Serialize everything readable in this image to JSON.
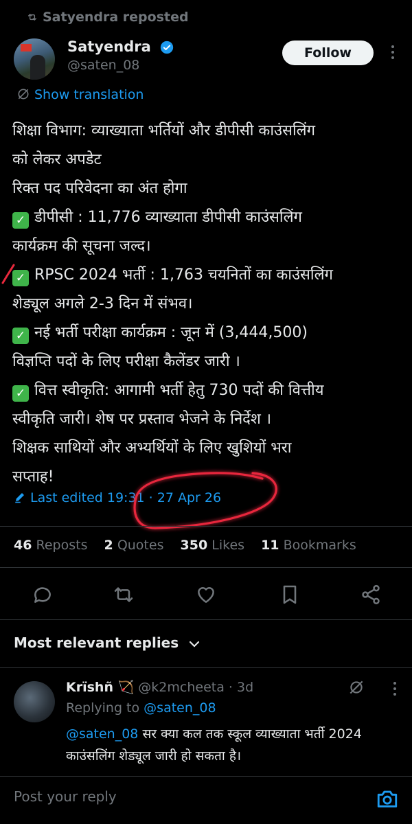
{
  "repost_bar": {
    "text": "Satyendra reposted"
  },
  "author": {
    "name": "Satyendra",
    "handle": "@saten_08"
  },
  "follow": {
    "label": "Follow"
  },
  "translate": {
    "label": "Show translation"
  },
  "post": {
    "lines": [
      "शिक्षा विभाग: व्याख्याता भर्तियों और डीपीसी काउंसलिंग",
      "को लेकर अपडेट",
      "रिक्त पद परिवेदना का अंत होगा",
      "डीपीसी : 11,776 व्याख्याता डीपीसी काउंसलिंग",
      "कार्यक्रम की सूचना जल्द।",
      "RPSC 2024 भर्ती : 1,763 चयनितों का काउंसलिंग",
      "शेड्यूल अगले 2-3 दिन में संभव।",
      "नई भर्ती परीक्षा कार्यक्रम : जून में (3,444,500)",
      "विज्ञप्ति पदों के लिए परीक्षा कैलेंडर जारी ।",
      "वित्त स्वीकृति: आगामी भर्ती हेतु 730 पदों की वित्तीय",
      "स्वीकृति जारी। शेष पर प्रस्ताव भेजने के निर्देश ।",
      "शिक्षक साथियों और अभ्यर्थियों के लिए खुशियों भरा",
      "सप्ताह!"
    ]
  },
  "edited": {
    "text": "Last edited 19:31 · 27 Apr 26"
  },
  "stats": {
    "reposts": "46",
    "reposts_label": "Reposts",
    "quotes": "2",
    "quotes_label": "Quotes",
    "likes": "350",
    "likes_label": "Likes",
    "bookmarks": "11",
    "bookmarks_label": "Bookmarks"
  },
  "replies_filter": {
    "label": "Most relevant replies"
  },
  "reply": {
    "name": "Krïshñ 🏹",
    "handle": "@k2mcheeta",
    "dot": "·",
    "time": "3d",
    "replying_prefix": "Replying to",
    "replying_handle": "@saten_08",
    "mention": "@saten_08",
    "line1_rest": " सर क्या कल तक स्कूल व्याख्याता भर्ती 2024",
    "line2": "काउंसलिंग शेड्यूल जारी हो सकता है।"
  },
  "composer": {
    "placeholder": "Post your reply"
  },
  "colors": {
    "accent": "#1d9bf0",
    "background": "#000000",
    "muted": "#71767b",
    "annotation": "#e8283c"
  },
  "icons": [
    "repost-icon",
    "verified-icon",
    "more-icon",
    "translate-icon",
    "edit-icon",
    "reply-icon",
    "retweet-icon",
    "like-icon",
    "bookmark-icon",
    "share-icon",
    "chevron-down-icon",
    "grok-icon",
    "camera-icon"
  ]
}
